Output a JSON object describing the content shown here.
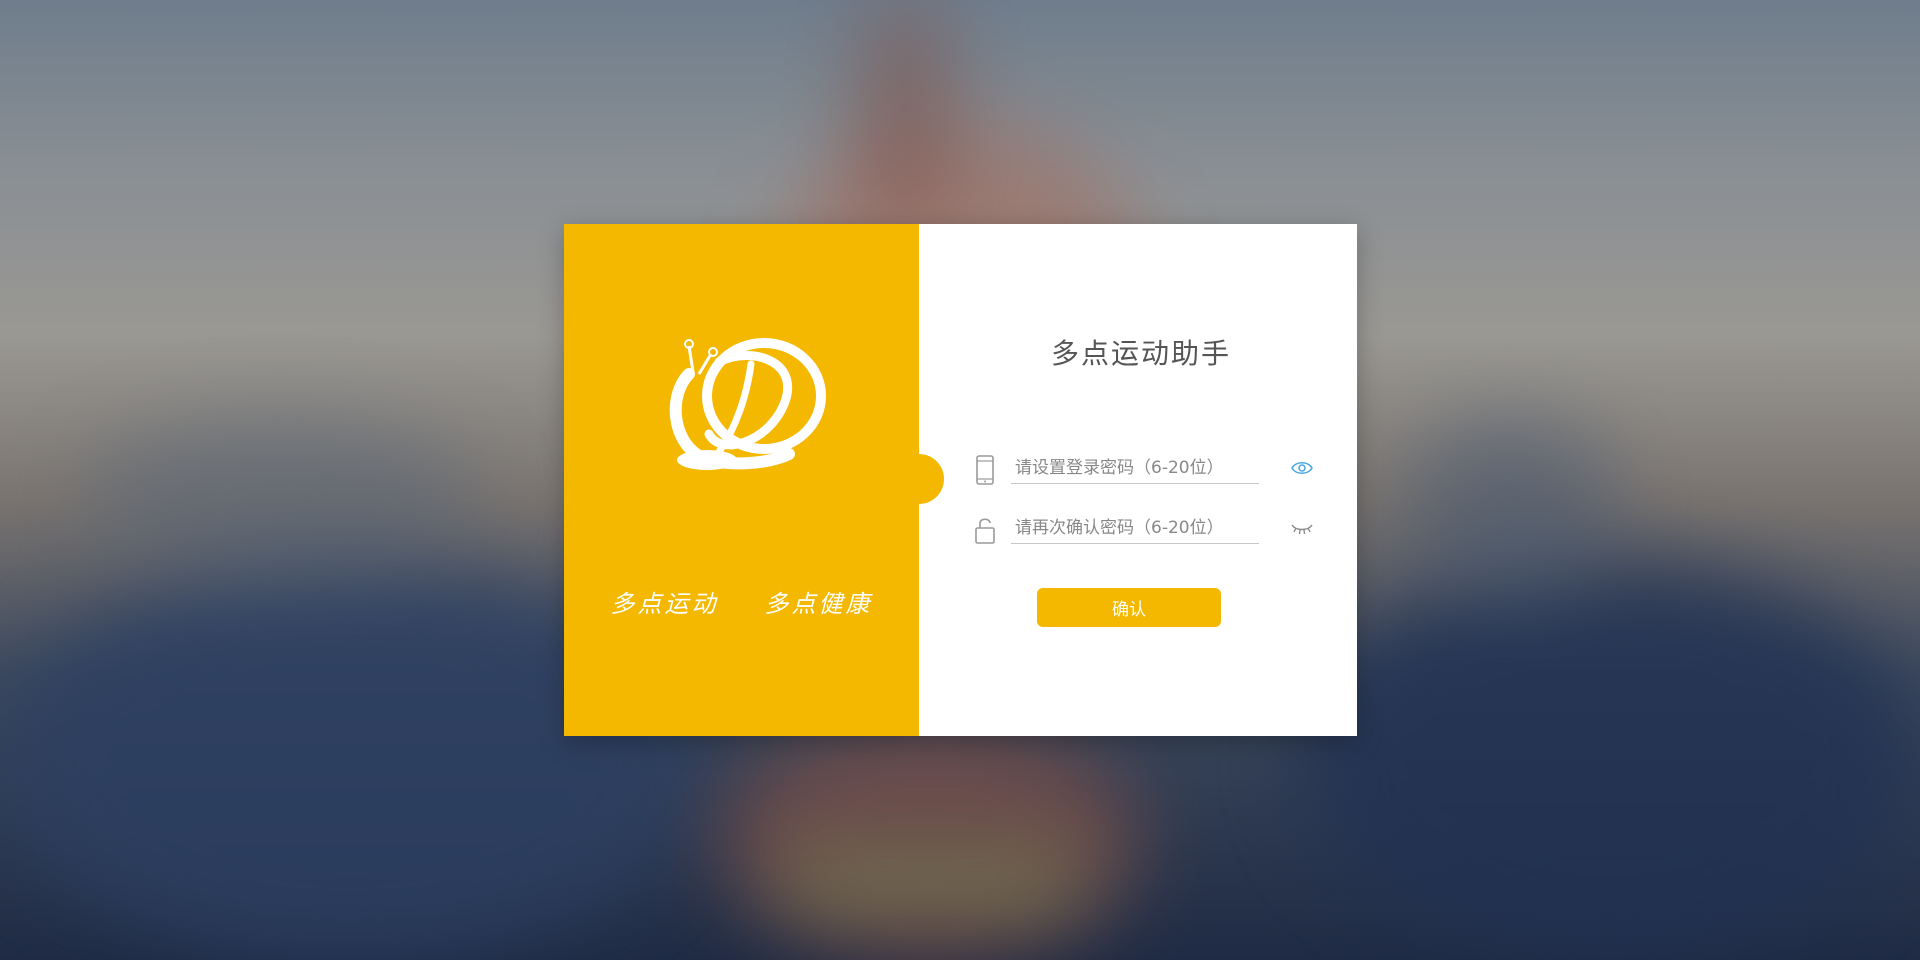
{
  "colors": {
    "accent": "#f4b800",
    "panel_bg": "#ffffff",
    "eye_active": "#4aa8e0",
    "icon_gray": "#9a9a9a"
  },
  "brand": {
    "logo_icon": "snail-d-logo",
    "slogan_left": "多点运动",
    "slogan_right": "多点健康"
  },
  "form": {
    "title": "多点运动助手",
    "password": {
      "icon": "phone-icon",
      "placeholder": "请设置登录密码（6-20位）",
      "value": "",
      "toggle_icon": "eye-open-icon"
    },
    "confirm_password": {
      "icon": "unlock-icon",
      "placeholder": "请再次确认密码（6-20位）",
      "value": "",
      "toggle_icon": "eye-closed-icon"
    },
    "submit_label": "确认"
  }
}
